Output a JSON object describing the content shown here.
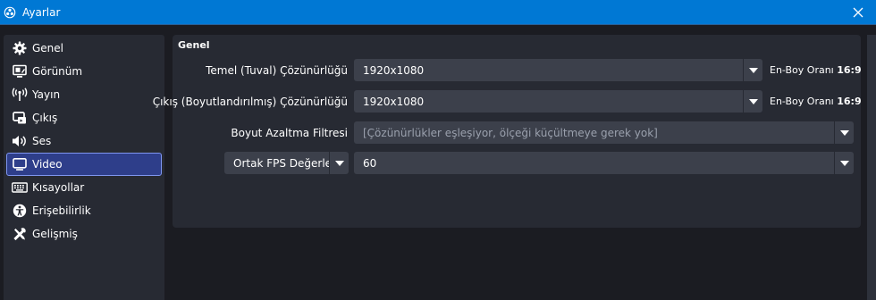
{
  "window": {
    "title": "Ayarlar"
  },
  "sidebar": {
    "items": [
      {
        "label": "Genel",
        "icon": "gear-icon"
      },
      {
        "label": "Görünüm",
        "icon": "appearance-icon"
      },
      {
        "label": "Yayın",
        "icon": "broadcast-icon"
      },
      {
        "label": "Çıkış",
        "icon": "output-icon"
      },
      {
        "label": "Ses",
        "icon": "speaker-icon"
      },
      {
        "label": "Video",
        "icon": "monitor-icon",
        "active": true
      },
      {
        "label": "Kısayollar",
        "icon": "keyboard-icon"
      },
      {
        "label": "Erişebilirlik",
        "icon": "accessibility-icon"
      },
      {
        "label": "Gelişmiş",
        "icon": "wrench-screwdriver-icon"
      }
    ]
  },
  "video": {
    "group_title": "Genel",
    "base_resolution": {
      "label": "Temel (Tuval) Çözünürlüğü",
      "value": "1920x1080",
      "aspect_label": "En-Boy Oranı",
      "aspect_value": "16:9"
    },
    "output_resolution": {
      "label": "Çıkış (Boyutlandırılmış) Çözünürlüğü",
      "value": "1920x1080",
      "aspect_label": "En-Boy Oranı",
      "aspect_value": "16:9"
    },
    "downscale_filter": {
      "label": "Boyut Azaltma Filtresi",
      "value": "[Çözünürlükler eşleşiyor, ölçeği küçültmeye gerek yok]"
    },
    "fps": {
      "type_value": "Ortak FPS Değerleri",
      "value": "60"
    }
  },
  "colors": {
    "titlebar": "#0078d4",
    "active_item_bg": "#2e3e8a",
    "active_item_border": "#7f96f0",
    "panel_bg": "#272a33",
    "input_bg": "#3c404b"
  }
}
